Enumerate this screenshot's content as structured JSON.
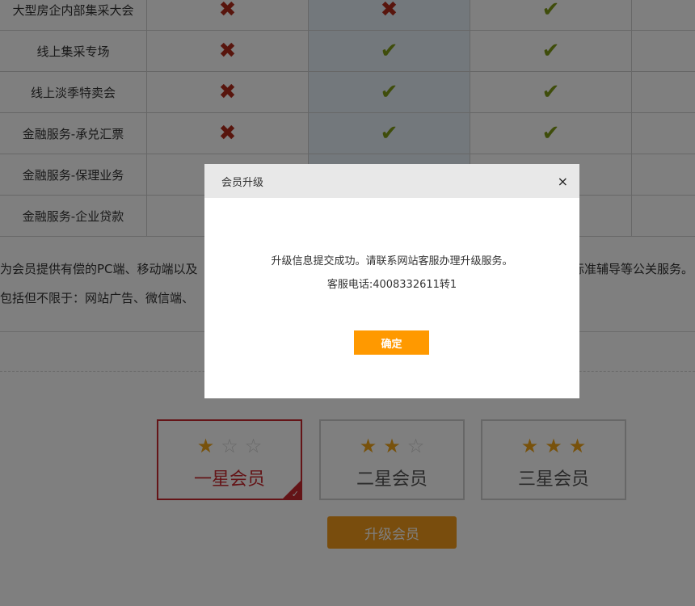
{
  "table": {
    "rows": [
      {
        "label": "大型房企内部集采大会",
        "cols": [
          "no",
          "no",
          "yes",
          ""
        ]
      },
      {
        "label": "线上集采专场",
        "cols": [
          "no",
          "yes",
          "yes",
          ""
        ]
      },
      {
        "label": "线上淡季特卖会",
        "cols": [
          "no",
          "yes",
          "yes",
          ""
        ]
      },
      {
        "label": "金融服务-承兑汇票",
        "cols": [
          "no",
          "yes",
          "yes",
          ""
        ]
      },
      {
        "label": "金融服务-保理业务",
        "cols": [
          "",
          "",
          "",
          ""
        ]
      },
      {
        "label": "金融服务-企业贷款",
        "cols": [
          "",
          "",
          "",
          ""
        ]
      }
    ],
    "marks": {
      "no": "✖",
      "yes": "✔"
    }
  },
  "description": {
    "line1_left": "为会员提供有偿的PC端、移动端以及",
    "line1_right": "标准辅导等公关服务。",
    "line2_left": "包括但不限于：网站广告、微信端、"
  },
  "tiers": [
    {
      "label": "一星会员",
      "stars": 1,
      "selected": true
    },
    {
      "label": "二星会员",
      "stars": 2,
      "selected": false
    },
    {
      "label": "三星会员",
      "stars": 3,
      "selected": false
    }
  ],
  "upgrade_button": "升级会员",
  "modal": {
    "title": "会员升级",
    "close": "×",
    "message": "升级信息提交成功。请联系网站客服办理升级服务。",
    "phone": "客服电话:4008332611转1",
    "confirm": "确定"
  },
  "colors": {
    "accent": "#ff9900",
    "selected": "#c9282e",
    "no": "#b02a1a",
    "yes": "#7e9a16"
  }
}
